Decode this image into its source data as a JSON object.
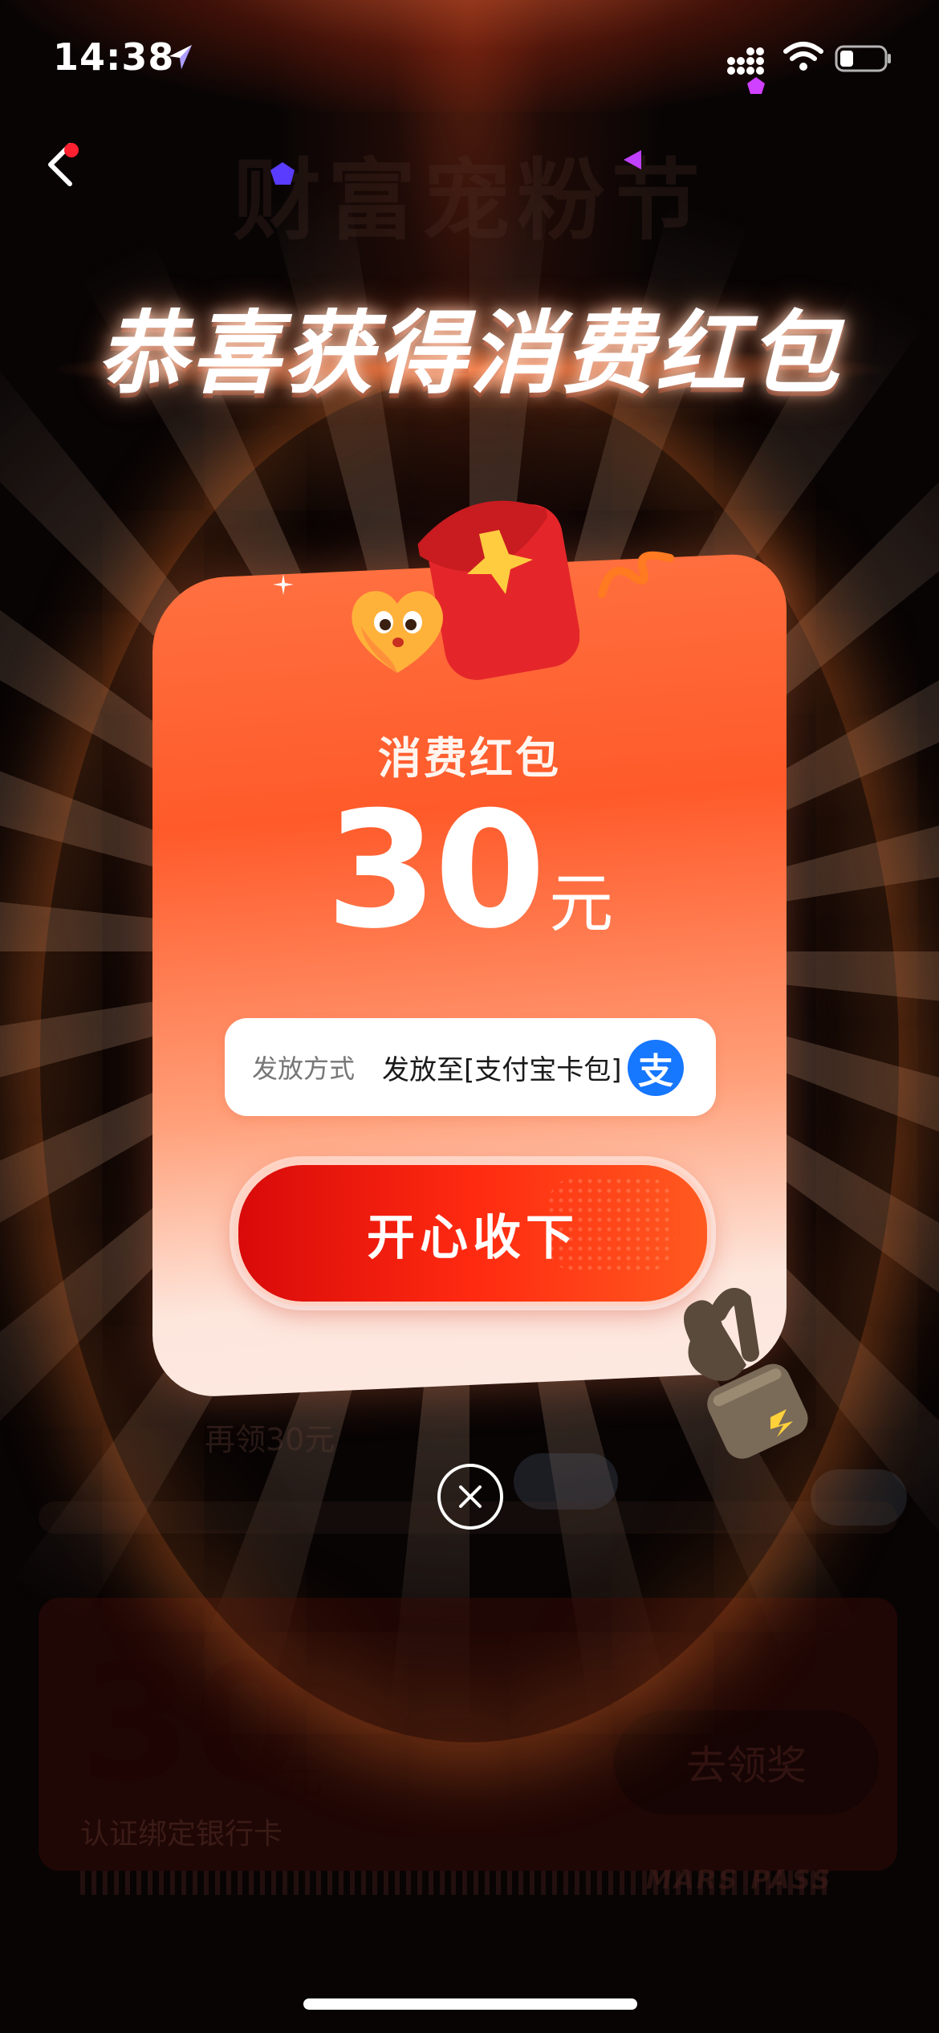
{
  "status_bar": {
    "time": "14:38"
  },
  "background_page": {
    "title": "财富宠粉节",
    "tip": "再领30元",
    "card_amount": "30",
    "card_amount_unit": "元",
    "card_desc": "认证绑定银行卡",
    "card_button": "去领奖",
    "pass_brand": "MARS PASS"
  },
  "modal": {
    "headline": "恭喜获得消费红包",
    "card_title": "消费红包",
    "amount": "30",
    "amount_unit": "元",
    "method_label": "发放方式",
    "method_value": "发放至[支付宝卡包]",
    "alipay_glyph": "支",
    "accept_button": "开心收下"
  },
  "colors": {
    "accent_red": "#e8160c",
    "card_orange": "#ff5a2a",
    "alipay_blue": "#1677ff"
  },
  "icons": [
    "back-icon",
    "location-arrow-icon",
    "signal-icon",
    "wifi-icon",
    "battery-icon",
    "alipay-icon",
    "close-icon",
    "red-packet-icon",
    "heart-icon",
    "hand-icon"
  ]
}
